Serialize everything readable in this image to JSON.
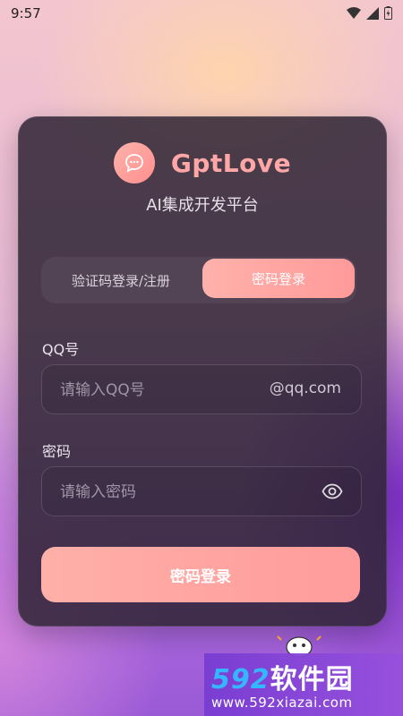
{
  "status_bar": {
    "time": "9:57"
  },
  "app": {
    "name": "GptLove",
    "subtitle": "AI集成开发平台"
  },
  "tabs": [
    {
      "label": "验证码登录/注册",
      "active": false
    },
    {
      "label": "密码登录",
      "active": true
    }
  ],
  "form": {
    "qq_label": "QQ号",
    "qq_placeholder": "请输入QQ号",
    "qq_value": "",
    "qq_suffix": "@qq.com",
    "password_label": "密码",
    "password_placeholder": "请输入密码",
    "password_value": "",
    "submit_label": "密码登录"
  },
  "watermark": {
    "brand_num": "592",
    "brand_text": "软件园",
    "url": "www.592xiazai.com"
  },
  "colors": {
    "accent": "#ff9e9e",
    "card_bg": "#2e2434",
    "brand_purple": "#8a4fd6"
  }
}
